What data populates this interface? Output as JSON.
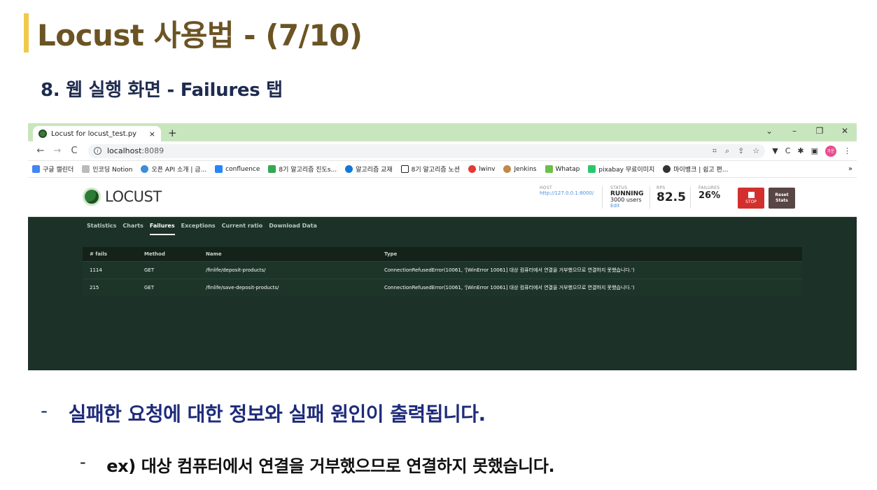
{
  "slide": {
    "title": "Locust 사용법 - (7/10)",
    "subtitle": "8. 웹 실행 화면 - Failures 탭",
    "bullet_marker": "-",
    "bullet1": "실패한 요청에 대한 정보와 실패 원인이 출력됩니다.",
    "bullet2": "ex) 대상 컴퓨터에서 연결을 거부했으므로 연결하지 못했습니다.",
    "accent_color": "#f2c84b",
    "title_color": "#6b5424"
  },
  "browser": {
    "tab_title": "Locust for locust_test.py",
    "tab_close": "×",
    "new_tab": "+",
    "window_controls": [
      "⌄",
      "–",
      "❐",
      "✕"
    ],
    "nav": {
      "back": "←",
      "forward": "→",
      "reload": "C"
    },
    "url_host": "localhost",
    "url_port": ":8089",
    "bookmarks": [
      {
        "label": "구글 캘린더",
        "color": "#4285f4"
      },
      {
        "label": "인코딩 Notion",
        "color": "#999999"
      },
      {
        "label": "오픈 API 소개 | 금...",
        "color": "#3b8fd9"
      },
      {
        "label": "confluence",
        "color": "#2684ff"
      },
      {
        "label": "8기 알고리즘 진도s...",
        "color": "#34a853"
      },
      {
        "label": "알고리즘 교재",
        "color": "#0f7ad8"
      },
      {
        "label": "8기 알고리즘 노션",
        "color": "#222222"
      },
      {
        "label": "lwinv",
        "color": "#e53935"
      },
      {
        "label": "Jenkins",
        "color": "#c0884b"
      },
      {
        "label": "Whatap",
        "color": "#6cbf4a"
      },
      {
        "label": "pixabay 무료이미지",
        "color": "#2ec66d"
      },
      {
        "label": "마이뱅크 | 쉽고 편...",
        "color": "#333333"
      }
    ],
    "bookmarks_more": "»",
    "profile_label": "가운"
  },
  "locust": {
    "logo_text": "LOCUST",
    "host_label": "HOST",
    "host_value": "http://127.0.0.1:8000/",
    "status_label": "STATUS",
    "status_value": "RUNNING",
    "users": "3000 users",
    "edit_link": "Edit",
    "rps_label": "RPS",
    "rps_value": "82.5",
    "failures_label": "FAILURES",
    "failures_value": "26%",
    "stop_label": "STOP",
    "reset_label": "Reset Stats",
    "tabs": [
      "Statistics",
      "Charts",
      "Failures",
      "Exceptions",
      "Current ratio",
      "Download Data"
    ],
    "active_tab": "Failures",
    "table": {
      "headers": [
        "# fails",
        "Method",
        "Name",
        "Type"
      ],
      "rows": [
        [
          "1114",
          "GET",
          "/finlife/deposit-products/",
          "ConnectionRefusedError(10061, '[WinError 10061] 대상 컴퓨터에서 연결을 거부했으므로 연결하지 못했습니다.')"
        ],
        [
          "215",
          "GET",
          "/finlife/save-deposit-products/",
          "ConnectionRefusedError(10061, '[WinError 10061] 대상 컴퓨터에서 연결을 거부했으므로 연결하지 못했습니다.')"
        ]
      ]
    }
  }
}
